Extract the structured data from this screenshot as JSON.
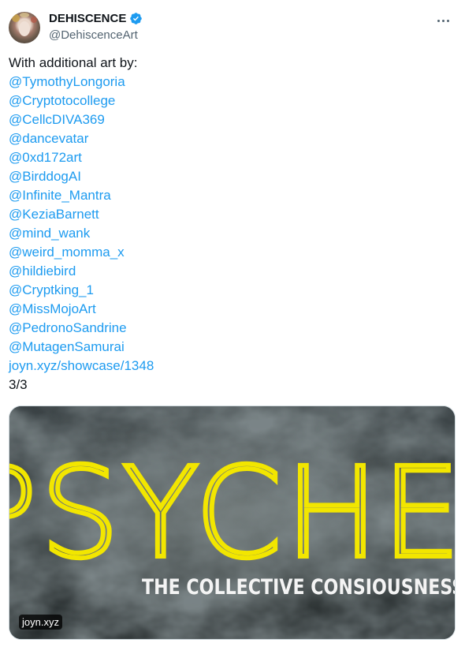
{
  "author": {
    "display_name": "DEHISCENCE",
    "handle": "@DehiscenceArt"
  },
  "tweet": {
    "intro": "With additional art by:",
    "mentions": [
      "@TymothyLongoria",
      "@Cryptotocollege",
      "@CellcDIVA369",
      "@dancevatar",
      "@0xd172art",
      "@BirddogAI",
      "@Infinite_Mantra",
      "@KeziaBarnett",
      "@mind_wank",
      "@weird_momma_x",
      "@hildiebird",
      "@Cryptking_1",
      "@MissMojoArt",
      "@PedronoSandrine",
      "@MutagenSamurai"
    ],
    "link": "joyn.xyz/showcase/1348",
    "thread_counter": "3/3"
  },
  "card": {
    "title_text": "PSYCHE",
    "subtitle_text": "THE COLLECTIVE CONSIOUSNESS OF AI",
    "domain": "joyn.xyz"
  },
  "colors": {
    "link": "#1d9bf0",
    "verified": "#1d9bf0",
    "card_title": "#f2e600",
    "secondary_text": "#536471"
  },
  "icons": [
    "verified-badge-icon",
    "more-options-icon"
  ]
}
